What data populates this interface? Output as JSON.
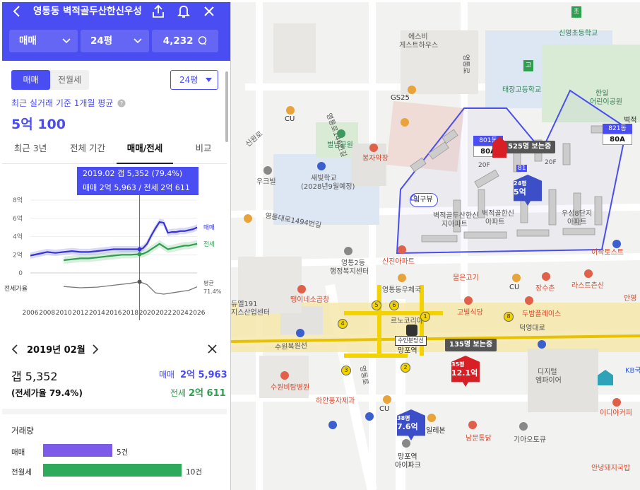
{
  "header": {
    "title": "영통동 벽적골두산한신우성",
    "deal_type": "매매",
    "area": "24평",
    "comment_count": "4,232"
  },
  "panel": {
    "segment": [
      "매매",
      "전월세"
    ],
    "pyeong_select": "24평",
    "avg_label": "최근 실거래 기준 1개월 평균",
    "avg_value": "5억 100",
    "tabs": [
      "최근 3년",
      "전체 기간",
      "매매/전세",
      "비교"
    ],
    "tooltip_line1": "2019.02  갭 5,352 (79.4%)",
    "tooltip_line2": "매매 2억 5,963 / 전세 2억 611",
    "selected_date": "2019년 02월",
    "gap": "갭 5,352",
    "ratio": "(전세가율 79.4%)",
    "sale_label": "매매",
    "sale_value": "2억 5,963",
    "jeonse_label": "전세",
    "jeonse_value": "2억 611",
    "volume_title": "거래량",
    "volume": [
      {
        "label": "매매",
        "count": "5건",
        "value": 5,
        "color": "#7b5be8"
      },
      {
        "label": "전월세",
        "count": "10건",
        "value": 10,
        "color": "#2daa5c"
      }
    ]
  },
  "chart_data": {
    "type": "line",
    "y_ticks": [
      "8억",
      "6억",
      "4억",
      "2억",
      "0",
      "전세가율"
    ],
    "x_ticks": [
      "2006",
      "2008",
      "2010",
      "2012",
      "2014",
      "2016",
      "2018",
      "2020",
      "2022",
      "2024",
      "2026"
    ],
    "ylim": [
      0,
      8
    ],
    "series": [
      {
        "name": "매매",
        "color": "#3434d8",
        "x": [
          2006,
          2007,
          2008,
          2009,
          2010,
          2011,
          2012,
          2013,
          2014,
          2015,
          2016,
          2017,
          2018,
          2019.1,
          2019.5,
          2020,
          2020.5,
          2021,
          2021.5,
          2022,
          2022.5,
          2023,
          2023.5,
          2024,
          2024.5,
          2025,
          2025.5,
          2026
        ],
        "values": [
          1.9,
          2.1,
          2.3,
          2.2,
          2.3,
          2.4,
          2.3,
          2.3,
          2.4,
          2.5,
          2.6,
          2.6,
          2.6,
          2.6,
          2.7,
          3.2,
          4.1,
          4.9,
          5.6,
          5.5,
          4.4,
          4.5,
          4.5,
          4.6,
          4.6,
          4.7,
          4.8,
          5.0
        ]
      },
      {
        "name": "전세",
        "color": "#2e9e4f",
        "x": [
          2010,
          2011,
          2012,
          2013,
          2014,
          2015,
          2016,
          2017,
          2018,
          2019.1,
          2019.5,
          2020,
          2020.5,
          2021,
          2021.5,
          2022,
          2022.5,
          2023,
          2023.5,
          2024,
          2024.5,
          2025,
          2025.5,
          2026
        ],
        "values": [
          1.4,
          1.5,
          1.6,
          1.6,
          1.7,
          1.8,
          1.9,
          2.0,
          2.0,
          2.06,
          2.1,
          2.3,
          2.6,
          2.9,
          3.2,
          2.9,
          2.6,
          2.7,
          2.8,
          2.9,
          3.0,
          3.0,
          3.1,
          3.2
        ]
      },
      {
        "name": "평균",
        "color": "#777777",
        "x": [
          2010,
          2012,
          2014,
          2016,
          2018,
          2019.1,
          2020,
          2021,
          2022,
          2023,
          2024,
          2025,
          2026
        ],
        "values": [
          72,
          70,
          71,
          74,
          77,
          79.4,
          75,
          62,
          60,
          62,
          64,
          66,
          71.4
        ]
      }
    ],
    "end_labels": [
      "매매",
      "전세",
      "평균",
      "71.4%"
    ]
  },
  "map": {
    "labels": [
      {
        "t": "에스비",
        "c": ""
      },
      {
        "t": "게스트하우스",
        "c": ""
      },
      {
        "t": "GS25",
        "c": "bold"
      },
      {
        "t": "CU",
        "c": "bold"
      },
      {
        "t": "신원로",
        "c": ""
      },
      {
        "t": "영통로146번길",
        "c": ""
      },
      {
        "t": "벌님공원",
        "c": "green"
      },
      {
        "t": "봉자약창",
        "c": "red"
      },
      {
        "t": "새빛학교",
        "c": ""
      },
      {
        "t": "(2028년9월예정)",
        "c": ""
      },
      {
        "t": "우크빌",
        "c": ""
      },
      {
        "t": "영통대로1494번길",
        "c": ""
      },
      {
        "t": "영통2동",
        "c": ""
      },
      {
        "t": "행정복지센터",
        "c": ""
      },
      {
        "t": "신진아파트",
        "c": "red"
      },
      {
        "t": "물은고기",
        "c": "red"
      },
      {
        "t": "영통동우체국",
        "c": ""
      },
      {
        "t": "땡이네소곱창",
        "c": "red"
      },
      {
        "t": "듀엘191",
        "c": ""
      },
      {
        "t": "지스산업센터",
        "c": ""
      },
      {
        "t": "장수촌",
        "c": "red"
      },
      {
        "t": "라스트츤신",
        "c": "red"
      },
      {
        "t": "CU",
        "c": "bold"
      },
      {
        "t": "안영",
        "c": "red"
      },
      {
        "t": "르노코리아",
        "c": ""
      },
      {
        "t": "고빌식당",
        "c": "red"
      },
      {
        "t": "두밤플레이스",
        "c": "red"
      },
      {
        "t": "덕영대로",
        "c": ""
      },
      {
        "t": "수원북원선",
        "c": ""
      },
      {
        "t": "망포역",
        "c": "bold"
      },
      {
        "t": "디지털",
        "c": ""
      },
      {
        "t": "엠파이어",
        "c": ""
      },
      {
        "t": "KB국",
        "c": "blue"
      },
      {
        "t": "이디야커피",
        "c": "red"
      },
      {
        "t": "수원비탐병원",
        "c": "red"
      },
      {
        "t": "하얀풍자제과",
        "c": "red"
      },
      {
        "t": "CU",
        "c": "bold"
      },
      {
        "t": "일레본",
        "c": "bold"
      },
      {
        "t": "남문통닭",
        "c": "red"
      },
      {
        "t": "기아오토큐",
        "c": ""
      },
      {
        "t": "망포역",
        "c": "bold"
      },
      {
        "t": "아이파크",
        "c": "bold"
      },
      {
        "t": "안녕돼지국밥",
        "c": "red"
      },
      {
        "t": "신영초등학교",
        "c": "green"
      },
      {
        "t": "태장고등학교",
        "c": "green"
      },
      {
        "t": "한일",
        "c": "green"
      },
      {
        "t": "어린이공원",
        "c": "green"
      },
      {
        "t": "벽적",
        "c": "bold"
      },
      {
        "t": "이삭토스트",
        "c": "red"
      },
      {
        "t": "벽적골한신",
        "c": ""
      },
      {
        "t": "아파트",
        "c": ""
      },
      {
        "t": "벽적골두산한신",
        "c": ""
      },
      {
        "t": "지아파트",
        "c": ""
      },
      {
        "t": "우성8단지",
        "c": ""
      },
      {
        "t": "아파트",
        "c": ""
      },
      {
        "t": "영통로",
        "c": ""
      },
      {
        "t": "영동로",
        "c": ""
      }
    ],
    "entrance": "입구뷰",
    "dongs": [
      {
        "num": "801동",
        "type": "80A"
      },
      {
        "num": "821동",
        "type": "80A"
      }
    ],
    "view_badges": [
      "525명 보는중",
      "135명 보는중"
    ],
    "pins": [
      {
        "py": "24평",
        "price": "5억",
        "color": "#3d4fc8"
      },
      {
        "py": "35평",
        "price": "12.1억",
        "color": "#d81f26"
      },
      {
        "py": "38평",
        "price": "7.6억",
        "color": "#3d4fc8"
      }
    ],
    "extras": [
      "81",
      "20F",
      "20F"
    ],
    "subway_station": "수인분당선",
    "numbers": [
      "5",
      "6",
      "4",
      "8",
      "1",
      "3",
      "2"
    ],
    "school_chars": [
      "초",
      "고"
    ]
  }
}
